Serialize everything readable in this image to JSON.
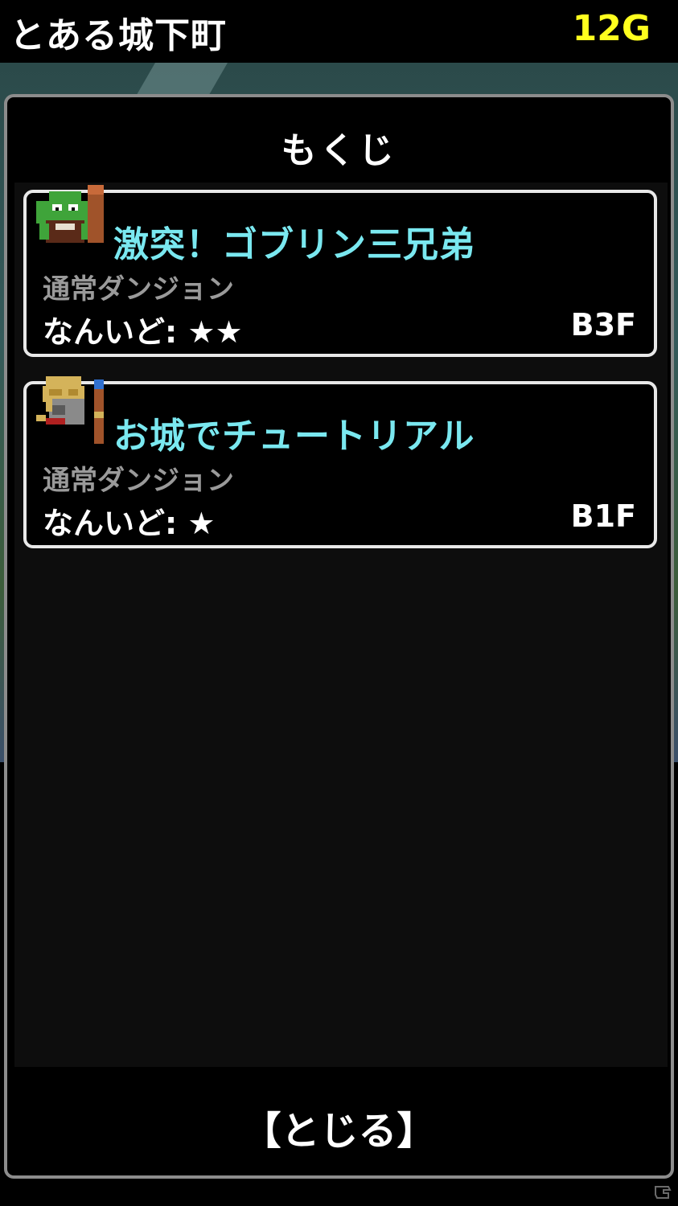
{
  "header": {
    "location": "とある城下町",
    "gold": "12G"
  },
  "window": {
    "title": "もくじ",
    "dungeons": [
      {
        "name": "激突！ゴブリン三兄弟",
        "type": "通常ダンジョン",
        "difficulty": "なんいど: ★★",
        "floor": "B3F",
        "icon": "goblin-icon"
      },
      {
        "name": "お城でチュートリアル",
        "type": "通常ダンジョン",
        "difficulty": "なんいど: ★",
        "floor": "B1F",
        "icon": "knight-icon"
      }
    ],
    "close_label": "【とじる】"
  },
  "colors": {
    "title_cyan": "#7ae8f0",
    "gold_yellow": "#ffff1e",
    "subtext_gray": "#9a9a9a",
    "frame_gray": "#8c8c8c"
  }
}
